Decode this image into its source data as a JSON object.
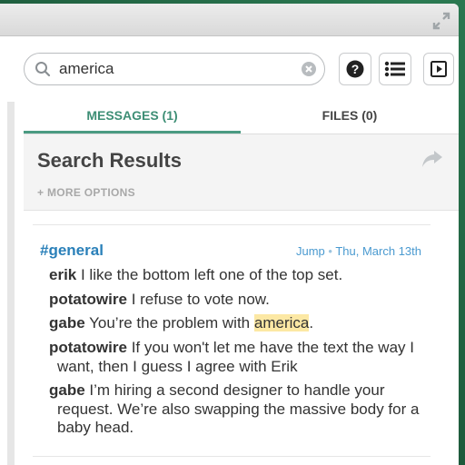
{
  "search": {
    "value": "america"
  },
  "tabs": [
    {
      "label": "MESSAGES (1)"
    },
    {
      "label": "FILES (0)"
    }
  ],
  "results": {
    "title": "Search Results",
    "more_options": "+ MORE OPTIONS"
  },
  "result": {
    "channel": "#general",
    "jump": "Jump",
    "separator": "•",
    "date": "Thu, March 13th",
    "messages": [
      {
        "author": "erik",
        "text": "I like the bottom left one of the top set."
      },
      {
        "author": "potatowire",
        "text": "I refuse to vote now."
      },
      {
        "author": "gabe",
        "text_before": "You’re the problem with ",
        "highlight": "america",
        "text_after": "."
      },
      {
        "author": "potatowire",
        "text": "If you won't let me have the text the way I want, then I guess I agree with Erik"
      },
      {
        "author": "gabe",
        "text": "I’m hiring a second designer to handle your request. We’re also swapping the massive body for a baby head."
      }
    ]
  },
  "colors": {
    "accent": "#4a9a82",
    "channel": "#2a80b9",
    "highlight": "#fce8a4"
  },
  "icons": [
    "fullscreen-icon",
    "search-icon",
    "clear-icon",
    "help-icon",
    "list-icon",
    "play-icon",
    "share-icon"
  ]
}
